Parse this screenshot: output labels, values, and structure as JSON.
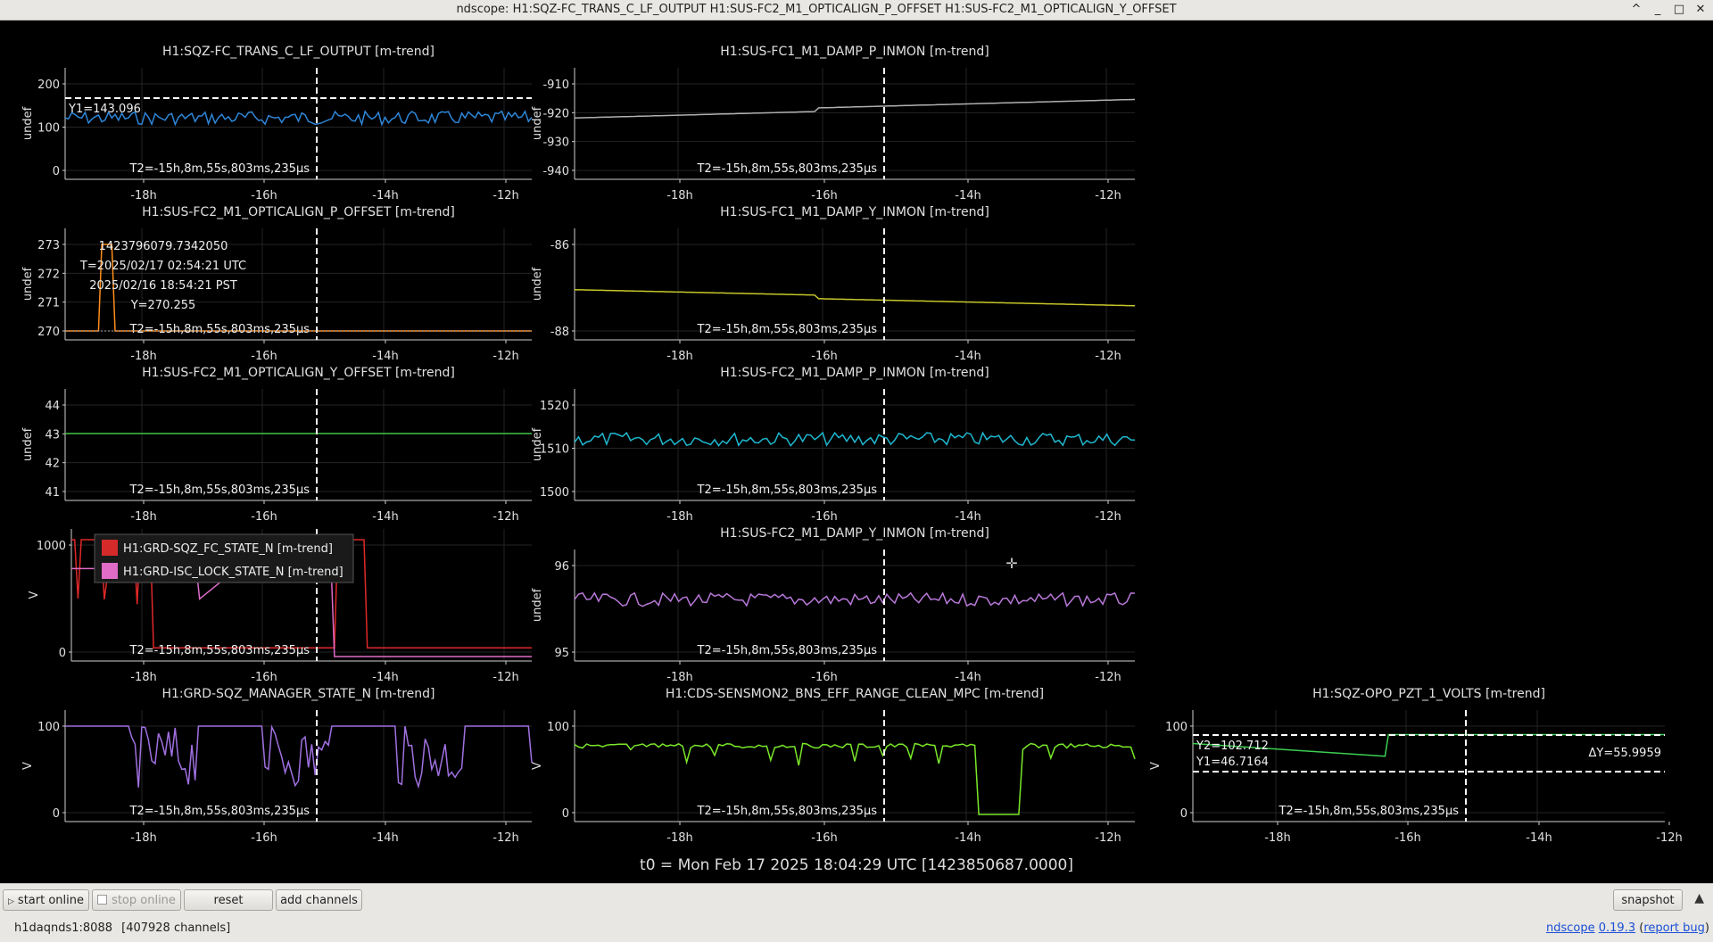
{
  "window": {
    "title": "ndscope: H1:SQZ-FC_TRANS_C_LF_OUTPUT H1:SUS-FC2_M1_OPTICALIGN_P_OFFSET H1:SUS-FC2_M1_OPTICALIGN_Y_OFFSET",
    "buttons": [
      "^",
      "_",
      "□",
      "✕"
    ]
  },
  "t_cursor_label": "T2=-15h,8m,55s,803ms,235μs",
  "x_ticks": [
    "-18h",
    "-16h",
    "-14h",
    "-12h"
  ],
  "plots": [
    {
      "title": "H1:SQZ-FC_TRANS_C_LF_OUTPUT [m-trend]",
      "ylabel": "undef",
      "yticks": [
        "200",
        "100",
        "0"
      ],
      "color": "#2e86d8",
      "y1_label": "Y1=143.096"
    },
    {
      "title": "H1:SUS-FC1_M1_DAMP_P_INMON [m-trend]",
      "ylabel": "undef",
      "yticks": [
        "-910",
        "-920",
        "-930",
        "-940"
      ],
      "color": "#b0b0b0"
    },
    {
      "title": "H1:SUS-FC2_M1_OPTICALIGN_P_OFFSET [m-trend]",
      "ylabel": "undef",
      "yticks": [
        "273",
        "272",
        "271",
        "270"
      ],
      "color": "#ff8c1a",
      "cursor_info": [
        "1423796079.7342050",
        "T=2025/02/17 02:54:21 UTC",
        "2025/02/16 18:54:21 PST",
        "Y=270.255"
      ]
    },
    {
      "title": "H1:SUS-FC1_M1_DAMP_Y_INMON [m-trend]",
      "ylabel": "undef",
      "yticks": [
        "-86",
        "-88"
      ],
      "color": "#c8c82a"
    },
    {
      "title": "H1:SUS-FC2_M1_OPTICALIGN_Y_OFFSET [m-trend]",
      "ylabel": "undef",
      "yticks": [
        "44",
        "43",
        "42",
        "41"
      ],
      "color": "#3fbf3f"
    },
    {
      "title": "H1:SUS-FC2_M1_DAMP_P_INMON [m-trend]",
      "ylabel": "undef",
      "yticks": [
        "1520",
        "1510",
        "1500"
      ],
      "color": "#1fb8d0"
    },
    {
      "title": "",
      "ylabel": "V",
      "yticks": [
        "1000",
        "0"
      ],
      "color": "#e02828",
      "legend": [
        {
          "label": "H1:GRD-SQZ_FC_STATE_N [m-trend]",
          "color": "#d42a2a"
        },
        {
          "label": "H1:GRD-ISC_LOCK_STATE_N [m-trend]",
          "color": "#e06cc8"
        }
      ]
    },
    {
      "title": "H1:SUS-FC2_M1_DAMP_Y_INMON [m-trend]",
      "ylabel": "undef",
      "yticks": [
        "96",
        "95"
      ],
      "color": "#b878d8"
    },
    {
      "title": "H1:GRD-SQZ_MANAGER_STATE_N [m-trend]",
      "ylabel": "V",
      "yticks": [
        "100",
        "0"
      ],
      "color": "#a070e0"
    },
    {
      "title": "H1:CDS-SENSMON2_BNS_EFF_RANGE_CLEAN_MPC [m-trend]",
      "ylabel": "V",
      "yticks": [
        "100",
        "0"
      ],
      "color": "#7ae82a"
    },
    {
      "title": "H1:SQZ-OPO_PZT_1_VOLTS [m-trend]",
      "ylabel": "V",
      "yticks": [
        "100",
        "0"
      ],
      "color": "#3ccf52",
      "y2_label": "Y2=102.712",
      "y1_label": "Y1=46.7164",
      "dy_label": "ΔY=55.9959"
    }
  ],
  "t0_label": "t0 = Mon Feb 17 2025 18:04:29 UTC [1423850687.0000]",
  "toolbar": {
    "start_online": "start online",
    "stop_online": "stop online",
    "reset": "reset",
    "add_channels": "add channels",
    "snapshot": "snapshot"
  },
  "status": {
    "server": "h1daqnds1:8088",
    "channels": "[407928 channels]"
  },
  "footer": {
    "app": "ndscope",
    "version": "0.19.3",
    "report": "report bug"
  }
}
